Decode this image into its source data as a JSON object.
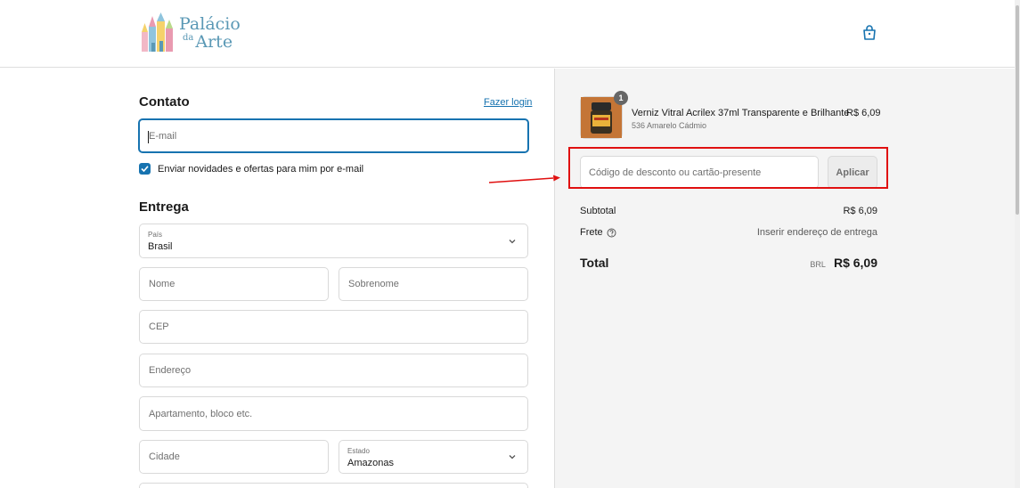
{
  "brand": {
    "line1": "Palácio",
    "small": "da",
    "line2": "Arte"
  },
  "contact": {
    "heading": "Contato",
    "login_link": "Fazer login",
    "email_placeholder": "E-mail",
    "newsletter_label": "Enviar novidades e ofertas para mim por e-mail",
    "newsletter_checked": true
  },
  "delivery": {
    "heading": "Entrega",
    "country_caption": "País",
    "country_value": "Brasil",
    "first_name_placeholder": "Nome",
    "last_name_placeholder": "Sobrenome",
    "cep_placeholder": "CEP",
    "address_placeholder": "Endereço",
    "apartment_placeholder": "Apartamento, bloco etc.",
    "city_placeholder": "Cidade",
    "state_caption": "Estado",
    "state_value": "Amazonas"
  },
  "summary": {
    "product": {
      "name": "Verniz Vitral Acrilex 37ml Transparente e Brilhante",
      "variant": "536 Amarelo Cádmio",
      "price": "R$ 6,09",
      "quantity": "1"
    },
    "discount_placeholder": "Código de desconto ou cartão-presente",
    "apply_label": "Aplicar",
    "subtotal_label": "Subtotal",
    "subtotal_value": "R$ 6,09",
    "shipping_label": "Frete",
    "shipping_value": "Inserir endereço de entrega",
    "total_label": "Total",
    "currency": "BRL",
    "total_value": "R$ 6,09"
  },
  "colors": {
    "accent": "#1773b0",
    "annotation_red": "#e01010",
    "summary_bg": "#f4f4f4"
  }
}
